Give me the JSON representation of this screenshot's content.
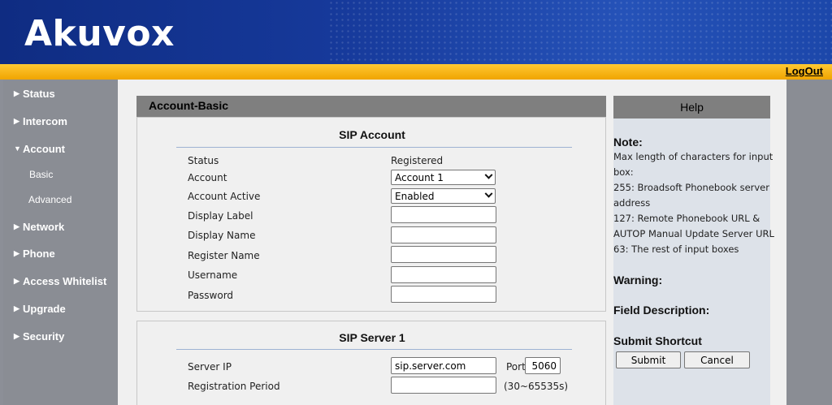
{
  "header": {
    "logo": "Akuvox",
    "logout": "LogOut"
  },
  "sidebar": {
    "items": [
      {
        "label": "Status",
        "arrow": "▶"
      },
      {
        "label": "Intercom",
        "arrow": "▶"
      },
      {
        "label": "Account",
        "arrow": "▼"
      },
      {
        "label": "Network",
        "arrow": "▶"
      },
      {
        "label": "Phone",
        "arrow": "▶"
      },
      {
        "label": "Access Whitelist",
        "arrow": "▶"
      },
      {
        "label": "Upgrade",
        "arrow": "▶"
      },
      {
        "label": "Security",
        "arrow": "▶"
      }
    ],
    "subitems": [
      {
        "label": "Basic"
      },
      {
        "label": "Advanced"
      }
    ]
  },
  "main": {
    "title": "Account-Basic",
    "sip_account": {
      "title": "SIP Account",
      "status_label": "Status",
      "status_value": "Registered",
      "account_label": "Account",
      "account_value": "Account 1",
      "account_active_label": "Account Active",
      "account_active_value": "Enabled",
      "display_label_label": "Display Label",
      "display_label_value": "",
      "display_name_label": "Display Name",
      "display_name_value": "",
      "register_name_label": "Register Name",
      "register_name_value": "",
      "username_label": "Username",
      "username_value": "",
      "password_label": "Password",
      "password_value": ""
    },
    "sip_server": {
      "title": "SIP Server 1",
      "server_ip_label": "Server IP",
      "server_ip_value": "sip.server.com",
      "port_label": "Port",
      "port_value": "5060",
      "registration_period_label": "Registration Period",
      "registration_period_value": "",
      "registration_period_range": "(30~65535s)"
    }
  },
  "help": {
    "title": "Help",
    "note_heading": "Note:",
    "note_lines": [
      "Max length of characters for input",
      "box:",
      "255: Broadsoft Phonebook server",
      "address",
      "127: Remote Phonebook URL &",
      "AUTOP Manual Update Server URL",
      "63: The rest of input boxes"
    ],
    "warning_heading": "Warning:",
    "field_description_heading": "Field Description:",
    "submit_shortcut_heading": "Submit Shortcut",
    "submit_button": "Submit",
    "cancel_button": "Cancel"
  },
  "colors": {
    "header_blue": "#16399a",
    "orange_bar": "#f7b81a",
    "sidebar_gray": "#8a8d94",
    "panel_title_gray": "#7f7f7f",
    "help_body": "#dde2e9"
  }
}
